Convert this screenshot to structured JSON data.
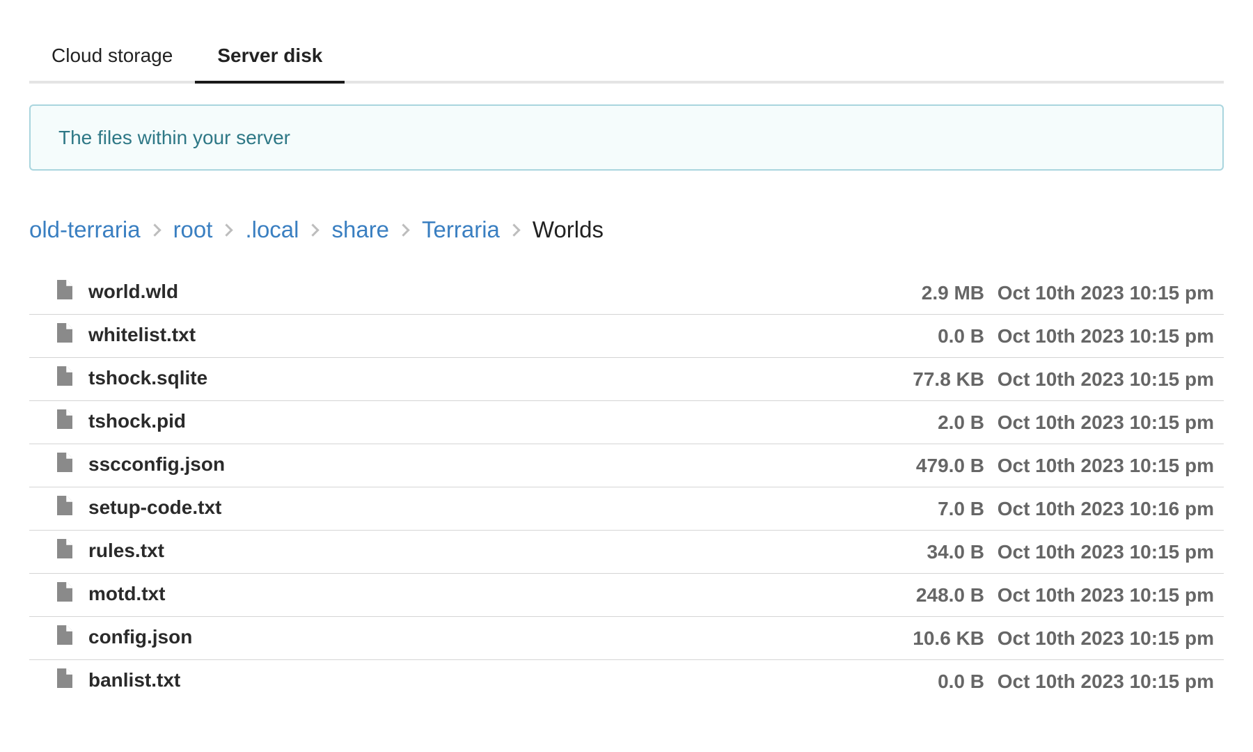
{
  "tabs": [
    {
      "label": "Cloud storage",
      "active": false
    },
    {
      "label": "Server disk",
      "active": true
    }
  ],
  "banner": {
    "text": "The files within your server"
  },
  "breadcrumb": [
    "old-terraria",
    "root",
    ".local",
    "share",
    "Terraria",
    "Worlds"
  ],
  "files": [
    {
      "name": "world.wld",
      "size": "2.9 MB",
      "modified": "Oct 10th 2023 10:15 pm",
      "icon": "file-icon"
    },
    {
      "name": "whitelist.txt",
      "size": "0.0 B",
      "modified": "Oct 10th 2023 10:15 pm",
      "icon": "file-icon"
    },
    {
      "name": "tshock.sqlite",
      "size": "77.8 KB",
      "modified": "Oct 10th 2023 10:15 pm",
      "icon": "file-icon"
    },
    {
      "name": "tshock.pid",
      "size": "2.0 B",
      "modified": "Oct 10th 2023 10:15 pm",
      "icon": "file-icon"
    },
    {
      "name": "sscconfig.json",
      "size": "479.0 B",
      "modified": "Oct 10th 2023 10:15 pm",
      "icon": "file-icon"
    },
    {
      "name": "setup-code.txt",
      "size": "7.0 B",
      "modified": "Oct 10th 2023 10:16 pm",
      "icon": "file-icon"
    },
    {
      "name": "rules.txt",
      "size": "34.0 B",
      "modified": "Oct 10th 2023 10:15 pm",
      "icon": "file-icon"
    },
    {
      "name": "motd.txt",
      "size": "248.0 B",
      "modified": "Oct 10th 2023 10:15 pm",
      "icon": "file-icon"
    },
    {
      "name": "config.json",
      "size": "10.6 KB",
      "modified": "Oct 10th 2023 10:15 pm",
      "icon": "file-icon"
    },
    {
      "name": "banlist.txt",
      "size": "0.0 B",
      "modified": "Oct 10th 2023 10:15 pm",
      "icon": "file-icon"
    }
  ],
  "colors": {
    "link": "#3a7fc1",
    "banner_text": "#2e7886",
    "banner_border": "#a9d5de",
    "banner_bg": "#f5fcfc",
    "icon": "#8a8a8a"
  }
}
